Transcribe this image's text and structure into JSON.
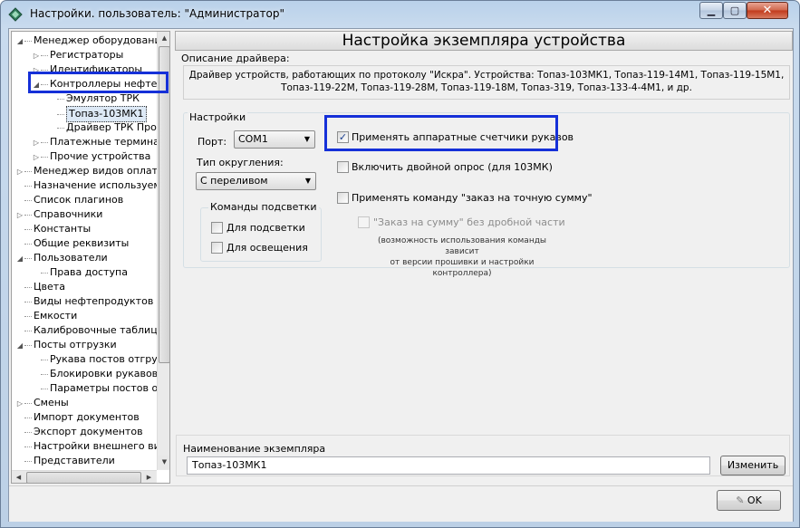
{
  "window": {
    "title": "Настройки. пользователь: \"Администратор\""
  },
  "tree": {
    "items": [
      {
        "label": "Менеджер оборудования",
        "toggle": "◢"
      },
      {
        "label": "Регистраторы",
        "toggle": "▷"
      },
      {
        "label": "Идентификаторы",
        "toggle": "▷"
      },
      {
        "label": "Контроллеры нефтепр",
        "toggle": "◢"
      },
      {
        "label": "Эмулятор ТРК",
        "toggle": ""
      },
      {
        "label": "Топаз-103МК1",
        "toggle": ""
      },
      {
        "label": "Драйвер ТРК Прот",
        "toggle": ""
      },
      {
        "label": "Платежные терминал",
        "toggle": "▷"
      },
      {
        "label": "Прочие устройства",
        "toggle": "▷"
      },
      {
        "label": "Менеджер видов оплаты",
        "toggle": "▷"
      },
      {
        "label": "Назначение используемых",
        "toggle": ""
      },
      {
        "label": "Список плагинов",
        "toggle": ""
      },
      {
        "label": "Справочники",
        "toggle": "▷"
      },
      {
        "label": "Константы",
        "toggle": ""
      },
      {
        "label": "Общие реквизиты",
        "toggle": ""
      },
      {
        "label": "Пользователи",
        "toggle": "◢"
      },
      {
        "label": "Права доступа",
        "toggle": ""
      },
      {
        "label": "Цвета",
        "toggle": ""
      },
      {
        "label": "Виды нефтепродуктов",
        "toggle": ""
      },
      {
        "label": "Емкости",
        "toggle": ""
      },
      {
        "label": "Калибровочные таблицы",
        "toggle": ""
      },
      {
        "label": "Посты отгрузки",
        "toggle": "◢"
      },
      {
        "label": "Рукава постов отгруз",
        "toggle": ""
      },
      {
        "label": "Блокировки рукавов",
        "toggle": ""
      },
      {
        "label": "Параметры постов отг",
        "toggle": ""
      },
      {
        "label": "Смены",
        "toggle": "▷"
      },
      {
        "label": "Импорт документов",
        "toggle": ""
      },
      {
        "label": "Экспорт документов",
        "toggle": ""
      },
      {
        "label": "Настройки внешнего вида",
        "toggle": ""
      },
      {
        "label": "Представители",
        "toggle": ""
      }
    ],
    "selected": "Топаз-103МК1"
  },
  "panel": {
    "header": "Настройка экземпляра устройства",
    "description_label": "Описание драйвера:",
    "description_line1": "Драйвер устройств, работающих по протоколу \"Искра\". Устройства: Топаз-103МК1, Топаз-119-14М1, Топаз-119-15М1,",
    "description_line2": "Топаз-119-22М, Топаз-119-28М, Топаз-119-18М, Топаз-319, Топаз-133-4-4М1, и др.",
    "settings_caption": "Настройки",
    "port_label": "Порт:",
    "port_value": "COM1",
    "rounding_label": "Тип округления:",
    "rounding_value": "С переливом",
    "backlight_caption": "Команды подсветки",
    "backlight_options": [
      "Для подсветки",
      "Для освещения"
    ],
    "options": [
      {
        "label": "Применять аппаратные счетчики рукавов",
        "checked": true
      },
      {
        "label": "Включить двойной опрос (для 103МК)",
        "checked": false
      },
      {
        "label": "Применять команду \"заказ на точную сумму\"",
        "checked": false
      }
    ],
    "sub_option": "\"Заказ на сумму\" без дробной части",
    "note_line1": "(возможность использования команды зависит",
    "note_line2": "от версии прошивки и настройки контроллера)",
    "instance_name_label": "Наименование экземпляра",
    "instance_name_value": "Топаз-103МК1",
    "change_button": "Изменить",
    "ok_button": "OK"
  }
}
